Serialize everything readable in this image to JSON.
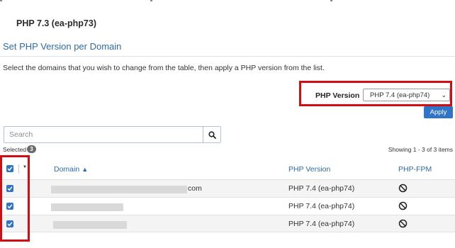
{
  "header": {
    "current_version": "PHP 7.3 (ea-php73)"
  },
  "section": {
    "title": "Set PHP Version per Domain",
    "instructions": "Select the domains that you wish to change from the table, then apply a PHP version from the list."
  },
  "version_selector": {
    "label": "PHP Version",
    "selected": "PHP 7.4 (ea-php74)",
    "apply_label": "Apply"
  },
  "search": {
    "placeholder": "Search"
  },
  "selection": {
    "label": "Selected",
    "count": "3",
    "showing": "Showing 1 - 3 of 3 items"
  },
  "table": {
    "columns": {
      "domain": "Domain",
      "php_version": "PHP Version",
      "php_fpm": "PHP-FPM"
    },
    "sort_indicator": "▲",
    "rows": [
      {
        "domain_suffix": "com",
        "php_version": "PHP 7.4 (ea-php74)",
        "checked": true,
        "php_fpm_icon": "disabled-icon"
      },
      {
        "domain_suffix": "",
        "php_version": "PHP 7.4 (ea-php74)",
        "checked": true,
        "php_fpm_icon": "disabled-icon"
      },
      {
        "domain_suffix": "",
        "php_version": "PHP 7.4 (ea-php74)",
        "checked": true,
        "php_fpm_icon": "disabled-icon"
      }
    ]
  },
  "colors": {
    "accent_blue": "#2f74c9",
    "link_blue": "#2e6ca8",
    "highlight_red": "#d40d12"
  }
}
